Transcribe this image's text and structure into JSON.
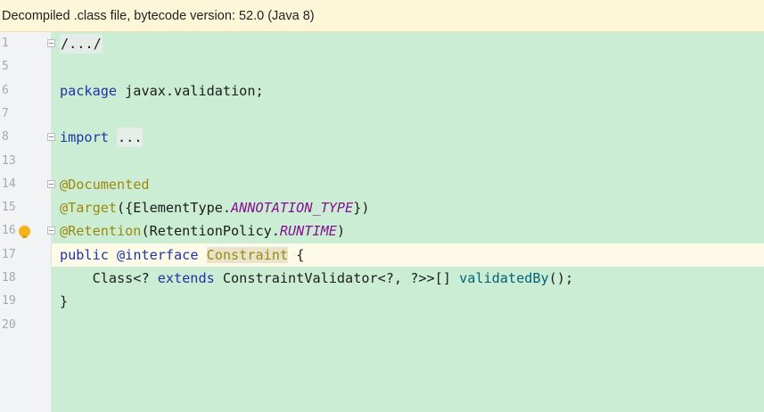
{
  "banner": {
    "text": "Decompiled .class file, bytecode version: 52.0 (Java 8)"
  },
  "line_numbers": [
    "1",
    "5",
    "6",
    "7",
    "8",
    "13",
    "14",
    "15",
    "16",
    "17",
    "18",
    "19",
    "20"
  ],
  "code": {
    "l1": {
      "folded": "/.../"
    },
    "l6": {
      "kw": "package",
      "rest": " javax.validation;"
    },
    "l8": {
      "kw": "import",
      "sp": " ",
      "folded": "..."
    },
    "l14": {
      "ann": "@Documented"
    },
    "l15": {
      "ann": "@Target",
      "a": "({ElementType.",
      "const": "ANNOTATION_TYPE",
      "b": "})"
    },
    "l16": {
      "ann": "@Retention",
      "a": "(RetentionPolicy.",
      "const": "RUNTIME",
      "b": ")"
    },
    "l17": {
      "kw1": "public",
      "a": " ",
      "kw2": "@interface",
      "b": " ",
      "name": "Constraint",
      "c": " {"
    },
    "l18": {
      "indent": "    ",
      "a": "Class<? ",
      "kw": "extends",
      "b": " ConstraintValidator<?, ?>>[] ",
      "meth": "validatedBy",
      "c": "();"
    },
    "l19": {
      "text": "}"
    }
  },
  "colors": {
    "editor_bg": "#cbedd3",
    "banner_bg": "#fdf6d8",
    "keyword": "#1f34a8",
    "annotation": "#9e880d",
    "constant": "#871094",
    "method": "#00627a"
  },
  "icons": {
    "intention_bulb": "lightbulb-icon"
  }
}
